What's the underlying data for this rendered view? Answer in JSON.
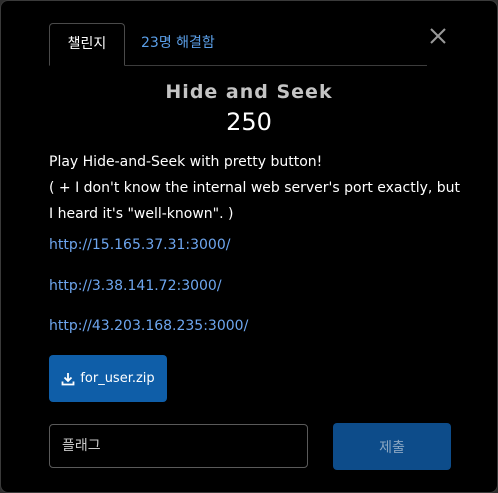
{
  "tabs": {
    "challenge_label": "챌린지",
    "solves_label": "23명 해결함"
  },
  "challenge": {
    "name": "Hide and Seek",
    "points": "250",
    "description_lines": [
      "Play Hide-and-Seek with pretty button!",
      "( + I don't know the internal web server's port exactly, but",
      "I heard it's \"well-known\". )"
    ],
    "links": [
      "http://15.165.37.31:3000/",
      "http://3.38.141.72:3000/",
      "http://43.203.168.235:3000/"
    ],
    "file_label": "for_user.zip"
  },
  "form": {
    "flag_placeholder": "플래그",
    "submit_label": "제출"
  },
  "icons": {
    "close": "close-icon",
    "download": "download-icon"
  },
  "colors": {
    "background": "#000000",
    "link": "#6ea6ef",
    "primary_button": "#0f5ea8",
    "submit_button": "#0d4c8a"
  }
}
